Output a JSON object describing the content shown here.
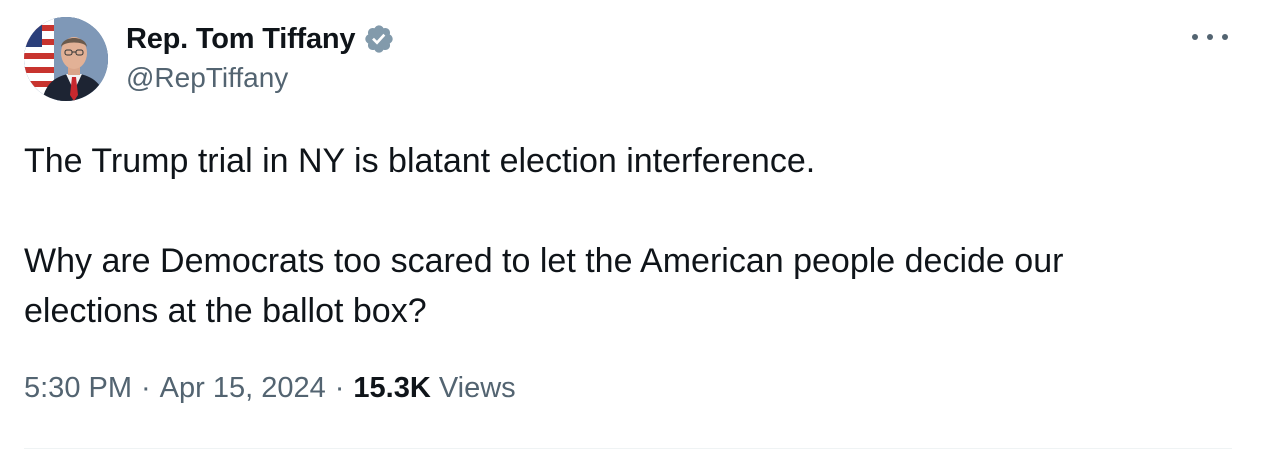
{
  "author": {
    "display_name": "Rep. Tom Tiffany",
    "handle": "@RepTiffany",
    "verified": true,
    "verified_badge_color": "#829aab",
    "avatar_icon": "profile-photo"
  },
  "menu": {
    "more_icon": "ellipsis-icon"
  },
  "tweet": {
    "paragraph_1": "The Trump trial in NY is blatant election interference.",
    "paragraph_2_line_1": "Why are Democrats too scared to let the American people decide our",
    "paragraph_2_line_2": "elections at the ballot box?"
  },
  "meta": {
    "time": "5:30 PM",
    "separator": "·",
    "date": "Apr 15, 2024",
    "views_count": "15.3K",
    "views_label": "Views"
  },
  "colors": {
    "text_primary": "#0f1419",
    "text_secondary": "#536471",
    "divider": "#eff3f4"
  }
}
